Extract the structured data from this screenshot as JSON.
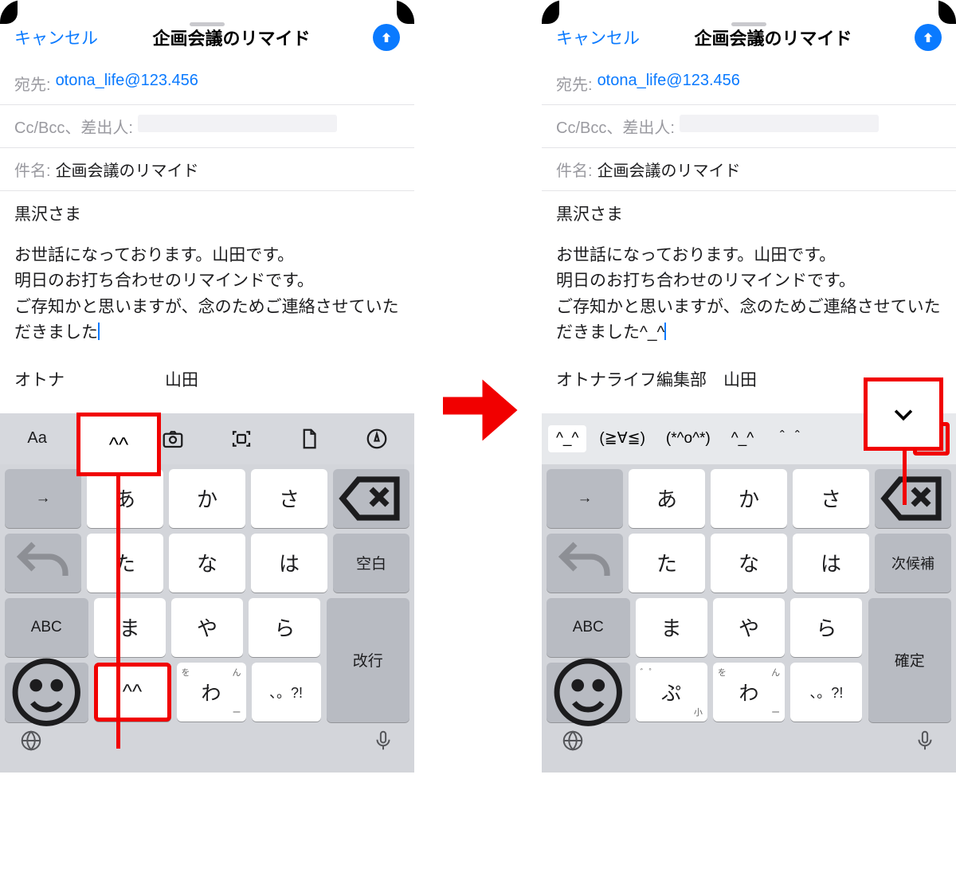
{
  "header": {
    "cancel": "キャンセル",
    "title": "企画会議のリマイド"
  },
  "fields": {
    "to_label": "宛先:",
    "to_value": "otona_life@123.456",
    "cc_label": "Cc/Bcc、差出人:",
    "subject_label": "件名:",
    "subject_value": "企画会議のリマイド"
  },
  "body": {
    "greeting": "黒沢さま",
    "p1": "お世話になっております。山田です。",
    "p2": "明日のお打ち合わせのリマインドです。",
    "p3": "ご存知かと思いますが、念のためご連絡させていただきました",
    "p3_suffix_right": "^_^"
  },
  "signature": {
    "left_prefix": "オトナ",
    "left_popup": "^^",
    "left_suffix": "山田",
    "right_full": "オトナライフ編集部　山田"
  },
  "toolbar": {
    "aa": "Aa"
  },
  "candidates": {
    "c1": "^_^",
    "c2": "(≧∀≦)",
    "c3": "(*^o^*)",
    "c4": "^_^",
    "c5": "＾＾"
  },
  "kbd": {
    "tab": "→",
    "a": "あ",
    "ka": "か",
    "sa": "さ",
    "ta": "た",
    "na": "な",
    "ha": "は",
    "ma": "ま",
    "ya": "や",
    "ra": "ら",
    "kao": "^^",
    "wa": "わ",
    "punct": "、。?!",
    "space_left": "空白",
    "space_right": "次候補",
    "abc": "ABC",
    "enter_left": "改行",
    "enter_right": "確定",
    "bottom_punct": "゛゜",
    "small": "小",
    "wa_mini_wo": "を",
    "wa_mini_n": "ん",
    "wa_mini_bar": "ー",
    "pu": "ぷ"
  }
}
